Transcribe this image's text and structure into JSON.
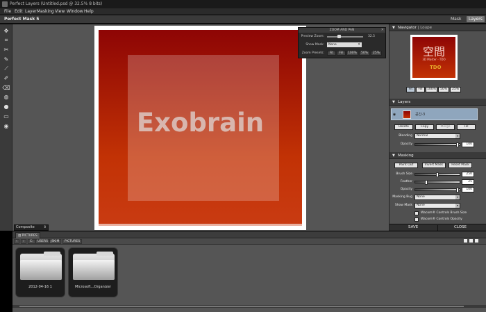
{
  "window": {
    "title": "Perfect Layers (Untitled.psd @ 32.5% 8 bits)"
  },
  "menu": {
    "items": [
      "File",
      "Edit",
      "Layer",
      "Masking",
      "View",
      "Window",
      "Help"
    ]
  },
  "app": {
    "name": "Perfect Mask 5",
    "tabs": [
      {
        "label": "Mask",
        "active": false
      },
      {
        "label": "Layers",
        "active": true
      }
    ]
  },
  "toolbar": {
    "tools": [
      "move-tool-icon",
      "crop-tool-icon",
      "cut-tool-icon",
      "brush-tool-icon",
      "chisel-tool-icon",
      "magic-brush-tool-icon",
      "eraser-tool-icon",
      "bucket-tool-icon",
      "blob-tool-icon",
      "rectangle-tool-icon",
      "hand-tool-icon"
    ]
  },
  "canvas": {
    "watermark": "Exobrain",
    "view_mode": "Composite"
  },
  "zoom_pan": {
    "title": "ZOOM AND PAN",
    "preview_zoom_label": "Preview Zoom:",
    "preview_zoom_value": "32.5",
    "preview_zoom_fraction": 0.33,
    "show_mask_label": "Show Mask:",
    "show_mask_value": "None",
    "zoom_presets_label": "Zoom Presets:",
    "presets": [
      "Fit",
      "Fill",
      "100%",
      "50%",
      "25%"
    ]
  },
  "navigator": {
    "title": "Navigator",
    "alt_tab": "Loupe",
    "thumb_title": "空間",
    "thumb_subtitle": "3D Master - TDO",
    "thumb_logo": "TDO",
    "buttons": [
      "Fit",
      "Fill",
      "100%",
      "50%",
      "25%"
    ],
    "active_button": "Fit"
  },
  "layers": {
    "title": "Layers",
    "items": [
      {
        "name": "공간-3"
      }
    ],
    "actions": [
      {
        "label": "Delete",
        "enabled": true
      },
      {
        "label": "Copy",
        "enabled": true
      },
      {
        "label": "Merge",
        "enabled": false
      },
      {
        "label": "Fill",
        "enabled": true
      }
    ],
    "blending_label": "Blending",
    "blending_value": "Normal",
    "opacity_label": "Opacity",
    "opacity_value": "100",
    "opacity_fraction": 1.0
  },
  "masking": {
    "title": "Masking",
    "buttons": [
      "Paint Out",
      "Invert Mask",
      "Reset Mask"
    ],
    "brush_size_label": "Brush Size",
    "brush_size_value": "250",
    "brush_size_fraction": 0.5,
    "feather_label": "Feather",
    "feather_value": "25",
    "feather_fraction": 0.25,
    "opacity_label": "Opacity",
    "opacity_value": "100",
    "opacity_fraction": 1.0,
    "masking_bug_label": "Masking Bug",
    "masking_bug_value": "None",
    "show_mask_label": "Show Mask",
    "show_mask_value": "None",
    "wacom_brush": "Wacom® Controls Brush Size",
    "wacom_opacity": "Wacom® Controls Opacity"
  },
  "panel_actions": {
    "save": "SAVE",
    "close": "CLOSE"
  },
  "browser": {
    "tab": "PICTURES",
    "path": [
      "‹",
      "›",
      "C:",
      "USERS",
      "JSKIM",
      "PICTURES"
    ],
    "folders": [
      {
        "name": "2012-04-16 1"
      },
      {
        "name": "Microsoft...Organizer"
      }
    ]
  }
}
